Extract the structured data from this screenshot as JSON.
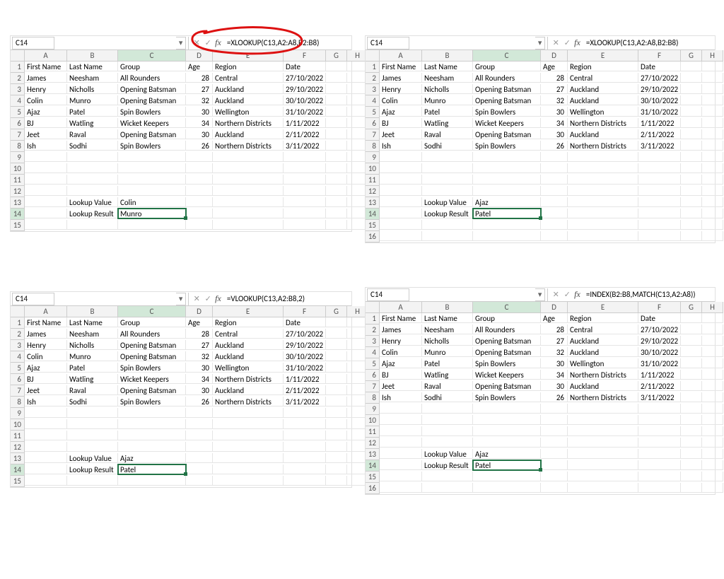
{
  "panels": [
    {
      "id": "p1",
      "cell_ref": "C14",
      "formula": "=XLOOKUP(C13,A2:A8,B2:B8)",
      "lookup_value": "Colin",
      "lookup_result": "Munro",
      "last_row": 15,
      "circled": true
    },
    {
      "id": "p2",
      "cell_ref": "C14",
      "formula": "=XLOOKUP(C13,A2:A8,B2:B8)",
      "lookup_value": "Ajaz",
      "lookup_result": "Patel",
      "last_row": 16,
      "circled": false
    },
    {
      "id": "p3",
      "cell_ref": "C14",
      "formula": "=VLOOKUP(C13,A2:B8,2)",
      "lookup_value": "Ajaz",
      "lookup_result": "Patel",
      "last_row": 15,
      "circled": false
    },
    {
      "id": "p4",
      "cell_ref": "C14",
      "formula": "=INDEX(B2:B8,MATCH(C13,A2:A8))",
      "lookup_value": "Ajaz",
      "lookup_result": "Patel",
      "last_row": 16,
      "circled": false
    }
  ],
  "columns": [
    "A",
    "B",
    "C",
    "D",
    "E",
    "F",
    "G",
    "H"
  ],
  "headers": {
    "first_name": "First Name",
    "last_name": "Last Name",
    "group": "Group",
    "age": "Age",
    "region": "Region",
    "date": "Date"
  },
  "table": [
    {
      "first": "James",
      "last": "Neesham",
      "group": "All Rounders",
      "age": 28,
      "region": "Central",
      "date": "27/10/2022"
    },
    {
      "first": "Henry",
      "last": "Nicholls",
      "group": "Opening Batsman",
      "age": 27,
      "region": "Auckland",
      "date": "29/10/2022"
    },
    {
      "first": "Colin",
      "last": "Munro",
      "group": "Opening Batsman",
      "age": 32,
      "region": "Auckland",
      "date": "30/10/2022"
    },
    {
      "first": "Ajaz",
      "last": "Patel",
      "group": "Spin Bowlers",
      "age": 30,
      "region": "Wellington",
      "date": "31/10/2022"
    },
    {
      "first": "BJ",
      "last": "Watling",
      "group": "Wicket Keepers",
      "age": 34,
      "region": "Northern Districts",
      "date": "1/11/2022"
    },
    {
      "first": "Jeet",
      "last": "Raval",
      "group": "Opening Batsman",
      "age": 30,
      "region": "Auckland",
      "date": "2/11/2022"
    },
    {
      "first": "Ish",
      "last": "Sodhi",
      "group": "Spin Bowlers",
      "age": 26,
      "region": "Northern Districts",
      "date": "3/11/2022"
    }
  ],
  "labels": {
    "lookup_value": "Lookup Value",
    "lookup_result": "Lookup Result"
  },
  "fx_glyphs": {
    "cancel": "✕",
    "enter": "✓",
    "fx": "fx",
    "dropdown": "▾"
  }
}
